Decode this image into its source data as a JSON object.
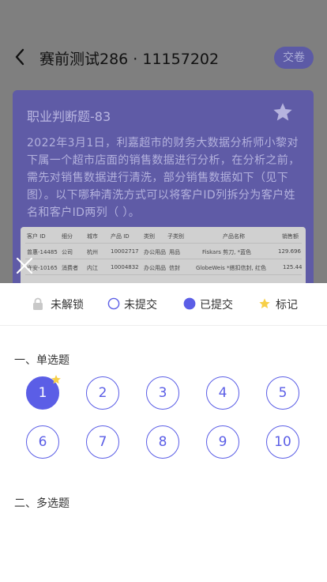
{
  "header": {
    "title": "赛前测试286 · 11157202",
    "submit_label": "交卷"
  },
  "question": {
    "title": "职业判断题-83",
    "body": "2022年3月1日，利嘉超市的财务大数据分析师小黎对下属一个超市店面的销售数据进行分析，在分析之前，需先对销售数据进行清洗，部分销售数据如下（见下图）。以下哪种清洗方式可以将客户ID列拆分为客户姓名和客户ID两列（ ）。",
    "table": {
      "headers": [
        "客户 ID",
        "细分",
        "城市",
        "产品 ID",
        "类别",
        "子类别",
        "产品名称",
        "销售额"
      ],
      "rows": [
        [
          "曾惠-14485",
          "公司",
          "杭州",
          "10002717",
          "办公用品",
          "用品",
          "Fiskars 剪刀, *蓝色",
          "129.696"
        ],
        [
          "许安-10165",
          "消费者",
          "内江",
          "10004832",
          "办公用品",
          "信封",
          "GlobeWeis *搭扣信封, 红色",
          "125.44"
        ]
      ]
    }
  },
  "legend": {
    "locked": "未解锁",
    "unsubmitted": "未提交",
    "submitted": "已提交",
    "marked": "标记"
  },
  "sections": {
    "single": "一、单选题",
    "multiple": "二、多选题"
  },
  "single_numbers": [
    "1",
    "2",
    "3",
    "4",
    "5",
    "6",
    "7",
    "8",
    "9",
    "10"
  ],
  "colors": {
    "accent": "#5b5ee6",
    "star": "#f7cf47"
  }
}
